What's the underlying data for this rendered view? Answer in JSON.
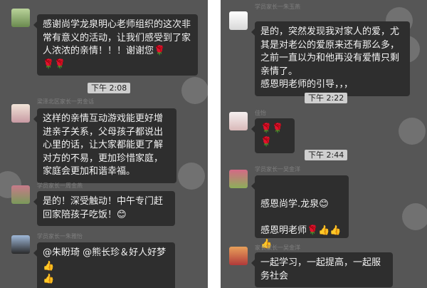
{
  "left": {
    "messages": [
      {
        "sender": "",
        "text": "感谢尚学龙泉明心老师组织的这次非常有意义的活动，让我们感受到了家人浓浓的亲情！！！谢谢您🌹",
        "trail": "🌹🌹"
      },
      {
        "sender": "梁泽北区家长一男金话",
        "text": "这样的亲情互动游戏能更好增进亲子关系，父母孩子都说出心里的话，让大家都能更了解对方的不易，更加珍惜家庭，家庭会更加和谐幸福。"
      },
      {
        "sender": "学员家长一周金燕",
        "text": "是的！深受触动！中午专门赶回家陪孩子吃饭！😊"
      },
      {
        "sender": "学员家长一朱雅怡",
        "text": "@朱盼琦 @熊长珍＆好人好梦 👍",
        "trail": "👍"
      }
    ],
    "time": "下午 2:08"
  },
  "right": {
    "messages": [
      {
        "sender": "学员家长一朱玉燕",
        "text": "是的，突然发现我对家人的爱，尤其是对老公的爱原来还有那么多，之前一直以为和他再没有爱情只剩亲情了。",
        "line2": "感恩明老师的引导，，，"
      },
      {
        "sender": "佳怡",
        "text": "🌹🌹🌹"
      },
      {
        "sender": "学员家长一吴金洋",
        "line1": "感恩尚学.龙泉😊",
        "line2": "感恩明老师🌹👍👍👍"
      },
      {
        "sender": "家长家长一吴金洋",
        "text": "一起学习，一起提高，一起服务社会"
      }
    ],
    "times": [
      "下午 2:22",
      "下午 2:44"
    ]
  },
  "colors": {
    "chat_bg": "#565656",
    "bubble_bg": "#2e2e2e",
    "time_bg": "#cfcfcf",
    "rose": "#d92b2b"
  }
}
